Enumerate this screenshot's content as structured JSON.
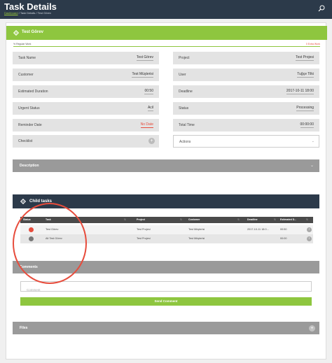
{
  "header": {
    "title": "Task Details",
    "breadcrumb_home": "Dashboard",
    "breadcrumb_rest": " / Task Details / Test Görev"
  },
  "card": {
    "title": "Test Görev",
    "info_left": "% Regular Work",
    "info_right": "0 Extra Work"
  },
  "fields": {
    "task_name": {
      "label": "Task Name",
      "value": "Test Görev"
    },
    "project": {
      "label": "Project",
      "value": "Test Projesi"
    },
    "customer": {
      "label": "Customer",
      "value": "Test Müşterisi"
    },
    "user": {
      "label": "User",
      "value": "Tuğçe Tilki"
    },
    "estimated_duration": {
      "label": "Estimated Duration",
      "value": "00:50"
    },
    "deadline": {
      "label": "Deadline",
      "value": "2017-10-11 18:00"
    },
    "urgent_status": {
      "label": "Urgent Status",
      "value": "Acil"
    },
    "status": {
      "label": "Status",
      "value": "Processing"
    },
    "reminder_date": {
      "label": "Reminder Date",
      "value": "No Date"
    },
    "total_time": {
      "label": "Total Time",
      "value": "00:00:00"
    },
    "checklist": {
      "label": "Checklist"
    },
    "actions": {
      "label": "Actions"
    }
  },
  "sections": {
    "description": "Description",
    "child_tasks": "Child tasks",
    "comments": "Comments",
    "files": "Files"
  },
  "child_table": {
    "columns": [
      "Status",
      "Task",
      "Project",
      "Customer",
      "Deadline",
      "Estimated D..."
    ],
    "rows": [
      {
        "status_color": "#e74c3c",
        "task": "Test Görev",
        "project": "Test Projesi",
        "customer": "Test Müşterisi",
        "deadline": "2017-10-11 18:0...",
        "estimated": "00:50"
      },
      {
        "status_color": "#777777",
        "task": "Alt Test Görev",
        "project": "Test Projesi",
        "customer": "Test Müşterisi",
        "deadline": "",
        "estimated": "00:00"
      }
    ]
  },
  "comments": {
    "placeholder": "Comment",
    "send_label": "Send Comment"
  },
  "colors": {
    "accent": "#8ec63f",
    "dark": "#2c3a4a",
    "highlight": "#e74c3c"
  }
}
